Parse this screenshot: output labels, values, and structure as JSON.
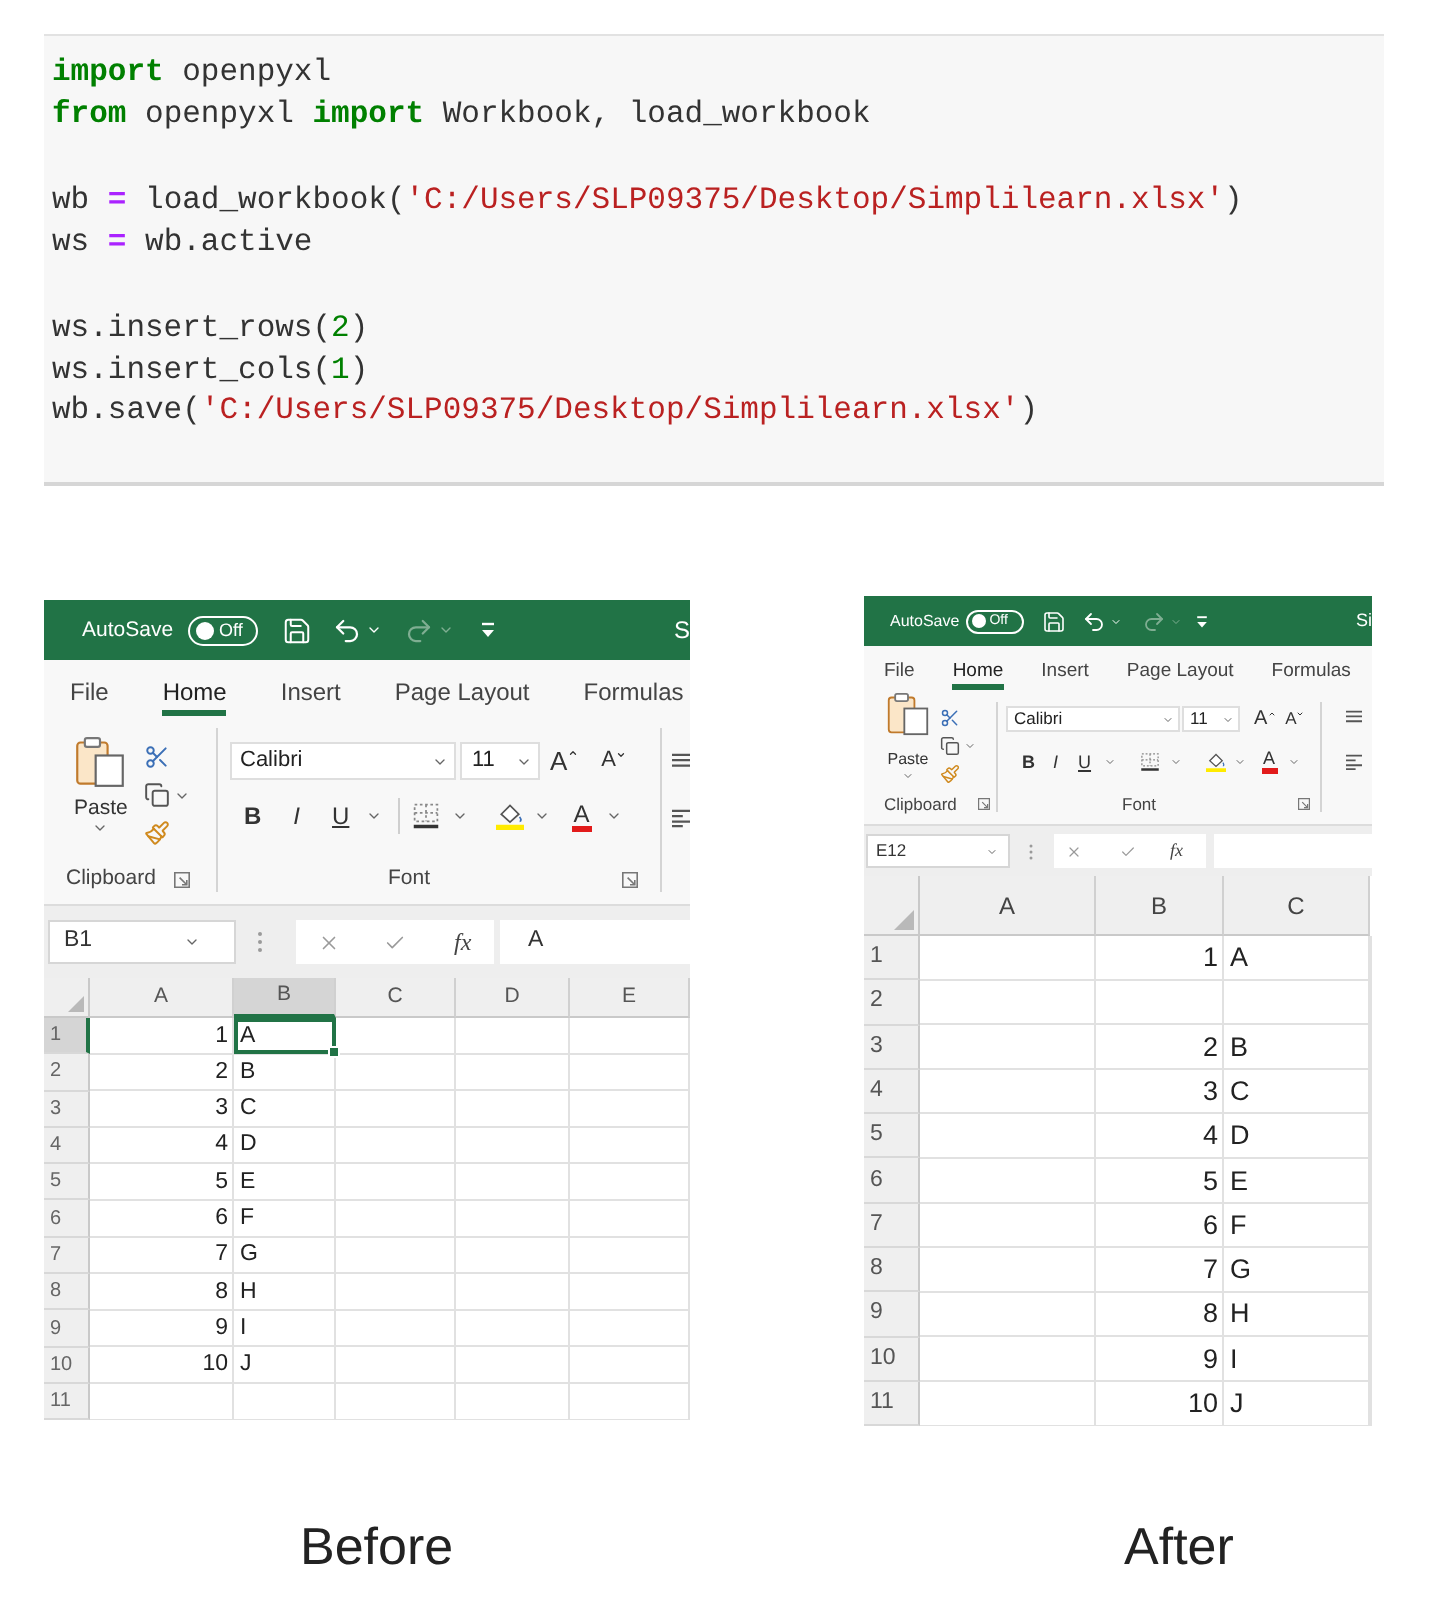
{
  "code": {
    "blocks": [
      [
        [
          {
            "kind": "keyword",
            "text": "import"
          },
          {
            "kind": "plain",
            "text": " openpyxl"
          }
        ],
        [
          {
            "kind": "keyword",
            "text": "from"
          },
          {
            "kind": "plain",
            "text": " openpyxl "
          },
          {
            "kind": "keyword",
            "text": "import"
          },
          {
            "kind": "plain",
            "text": " Workbook, load_workbook"
          }
        ]
      ],
      [
        [
          {
            "kind": "plain",
            "text": "wb "
          },
          {
            "kind": "operator",
            "text": "="
          },
          {
            "kind": "plain",
            "text": " load_workbook("
          },
          {
            "kind": "string",
            "text": "'C:/Users/SLP09375/Desktop/Simplilearn.xlsx'"
          },
          {
            "kind": "plain",
            "text": ")"
          }
        ],
        [
          {
            "kind": "plain",
            "text": "ws "
          },
          {
            "kind": "operator",
            "text": "="
          },
          {
            "kind": "plain",
            "text": " wb.active"
          }
        ]
      ],
      [
        [
          {
            "kind": "plain",
            "text": "ws.insert_rows("
          },
          {
            "kind": "number",
            "text": "2"
          },
          {
            "kind": "plain",
            "text": ")"
          }
        ],
        [
          {
            "kind": "plain",
            "text": "ws.insert_cols("
          },
          {
            "kind": "number",
            "text": "1"
          },
          {
            "kind": "plain",
            "text": ")"
          }
        ],
        [
          {
            "kind": "plain",
            "text": "wb.save("
          },
          {
            "kind": "string",
            "text": "'C:/Users/SLP09375/Desktop/Simplilearn.xlsx'"
          },
          {
            "kind": "plain",
            "text": ")"
          }
        ]
      ]
    ]
  },
  "figures": [
    {
      "caption": "Before",
      "window": {
        "title_bar": {
          "autosave_label": "AutoSave",
          "autosave": {
            "label": "Off",
            "on": false
          },
          "title": "S"
        },
        "tabs": [
          {
            "label": "File",
            "selected": false
          },
          {
            "label": "Home",
            "selected": true
          },
          {
            "label": "Insert",
            "selected": false
          },
          {
            "label": "Page Layout",
            "selected": false
          },
          {
            "label": "Formulas",
            "selected": false
          }
        ],
        "ribbon": {
          "clipboard": {
            "paste_label": "Paste",
            "group_label": "Clipboard"
          },
          "font": {
            "font_name": "Calibri",
            "font_size": "11",
            "grow_label": "A",
            "shrink_label": "A",
            "bold_label": "B",
            "italic_label": "I",
            "underline_label": "U",
            "font_color_label": "A",
            "group_label": "Font"
          }
        },
        "formula_bar": {
          "name_box": "B1",
          "function_label": "fx",
          "value": "A"
        },
        "sheet": {
          "columns": [
            {
              "label": "A",
              "selected": false
            },
            {
              "label": "B",
              "selected": true
            },
            {
              "label": "C",
              "selected": false
            },
            {
              "label": "D",
              "selected": false
            },
            {
              "label": "E",
              "selected": false
            }
          ],
          "rows": [
            {
              "header": "1",
              "selected": true,
              "cells": [
                {
                  "kind": "number",
                  "text": "1"
                },
                {
                  "kind": "text",
                  "text": "A"
                },
                null,
                null,
                null
              ]
            },
            {
              "header": "2",
              "selected": false,
              "cells": [
                {
                  "kind": "number",
                  "text": "2"
                },
                {
                  "kind": "text",
                  "text": "B"
                },
                null,
                null,
                null
              ]
            },
            {
              "header": "3",
              "selected": false,
              "cells": [
                {
                  "kind": "number",
                  "text": "3"
                },
                {
                  "kind": "text",
                  "text": "C"
                },
                null,
                null,
                null
              ]
            },
            {
              "header": "4",
              "selected": false,
              "cells": [
                {
                  "kind": "number",
                  "text": "4"
                },
                {
                  "kind": "text",
                  "text": "D"
                },
                null,
                null,
                null
              ]
            },
            {
              "header": "5",
              "selected": false,
              "cells": [
                {
                  "kind": "number",
                  "text": "5"
                },
                {
                  "kind": "text",
                  "text": "E"
                },
                null,
                null,
                null
              ]
            },
            {
              "header": "6",
              "selected": false,
              "cells": [
                {
                  "kind": "number",
                  "text": "6"
                },
                {
                  "kind": "text",
                  "text": "F"
                },
                null,
                null,
                null
              ]
            },
            {
              "header": "7",
              "selected": false,
              "cells": [
                {
                  "kind": "number",
                  "text": "7"
                },
                {
                  "kind": "text",
                  "text": "G"
                },
                null,
                null,
                null
              ]
            },
            {
              "header": "8",
              "selected": false,
              "cells": [
                {
                  "kind": "number",
                  "text": "8"
                },
                {
                  "kind": "text",
                  "text": "H"
                },
                null,
                null,
                null
              ]
            },
            {
              "header": "9",
              "selected": false,
              "cells": [
                {
                  "kind": "number",
                  "text": "9"
                },
                {
                  "kind": "text",
                  "text": "I"
                },
                null,
                null,
                null
              ]
            },
            {
              "header": "10",
              "selected": false,
              "cells": [
                {
                  "kind": "number",
                  "text": "10"
                },
                {
                  "kind": "text",
                  "text": "J"
                },
                null,
                null,
                null
              ]
            },
            {
              "header": "11",
              "selected": false,
              "cells": [
                null,
                null,
                null,
                null,
                null
              ]
            }
          ]
        }
      }
    },
    {
      "caption": "After",
      "window": {
        "title_bar": {
          "autosave_label": "AutoSave",
          "autosave": {
            "label": "Off",
            "on": false
          },
          "title": "Si"
        },
        "tabs": [
          {
            "label": "File",
            "selected": false
          },
          {
            "label": "Home",
            "selected": true
          },
          {
            "label": "Insert",
            "selected": false
          },
          {
            "label": "Page Layout",
            "selected": false
          },
          {
            "label": "Formulas",
            "selected": false
          }
        ],
        "ribbon": {
          "clipboard": {
            "paste_label": "Paste",
            "group_label": "Clipboard"
          },
          "font": {
            "font_name": "Calibri",
            "font_size": "11",
            "grow_label": "A",
            "shrink_label": "A",
            "bold_label": "B",
            "italic_label": "I",
            "underline_label": "U",
            "font_color_label": "A",
            "group_label": "Font"
          }
        },
        "formula_bar": {
          "name_box": "E12",
          "function_label": "fx"
        },
        "sheet": {
          "columns": [
            {
              "label": "A",
              "selected": false
            },
            {
              "label": "B",
              "selected": false
            },
            {
              "label": "C",
              "selected": false
            }
          ],
          "rows": [
            {
              "header": "1",
              "selected": false,
              "cells": [
                null,
                {
                  "kind": "number",
                  "text": "1"
                },
                {
                  "kind": "text",
                  "text": "A"
                }
              ]
            },
            {
              "header": "2",
              "selected": false,
              "cells": [
                null,
                null,
                null
              ]
            },
            {
              "header": "3",
              "selected": false,
              "cells": [
                null,
                {
                  "kind": "number",
                  "text": "2"
                },
                {
                  "kind": "text",
                  "text": "B"
                }
              ]
            },
            {
              "header": "4",
              "selected": false,
              "cells": [
                null,
                {
                  "kind": "number",
                  "text": "3"
                },
                {
                  "kind": "text",
                  "text": "C"
                }
              ]
            },
            {
              "header": "5",
              "selected": false,
              "cells": [
                null,
                {
                  "kind": "number",
                  "text": "4"
                },
                {
                  "kind": "text",
                  "text": "D"
                }
              ]
            },
            {
              "header": "6",
              "selected": false,
              "cells": [
                null,
                {
                  "kind": "number",
                  "text": "5"
                },
                {
                  "kind": "text",
                  "text": "E"
                }
              ]
            },
            {
              "header": "7",
              "selected": false,
              "cells": [
                null,
                {
                  "kind": "number",
                  "text": "6"
                },
                {
                  "kind": "text",
                  "text": "F"
                }
              ]
            },
            {
              "header": "8",
              "selected": false,
              "cells": [
                null,
                {
                  "kind": "number",
                  "text": "7"
                },
                {
                  "kind": "text",
                  "text": "G"
                }
              ]
            },
            {
              "header": "9",
              "selected": false,
              "cells": [
                null,
                {
                  "kind": "number",
                  "text": "8"
                },
                {
                  "kind": "text",
                  "text": "H"
                }
              ]
            },
            {
              "header": "10",
              "selected": false,
              "cells": [
                null,
                {
                  "kind": "number",
                  "text": "9"
                },
                {
                  "kind": "text",
                  "text": "I"
                }
              ]
            },
            {
              "header": "11",
              "selected": false,
              "cells": [
                null,
                {
                  "kind": "number",
                  "text": "10"
                },
                {
                  "kind": "text",
                  "text": "J"
                }
              ]
            }
          ]
        }
      }
    }
  ]
}
